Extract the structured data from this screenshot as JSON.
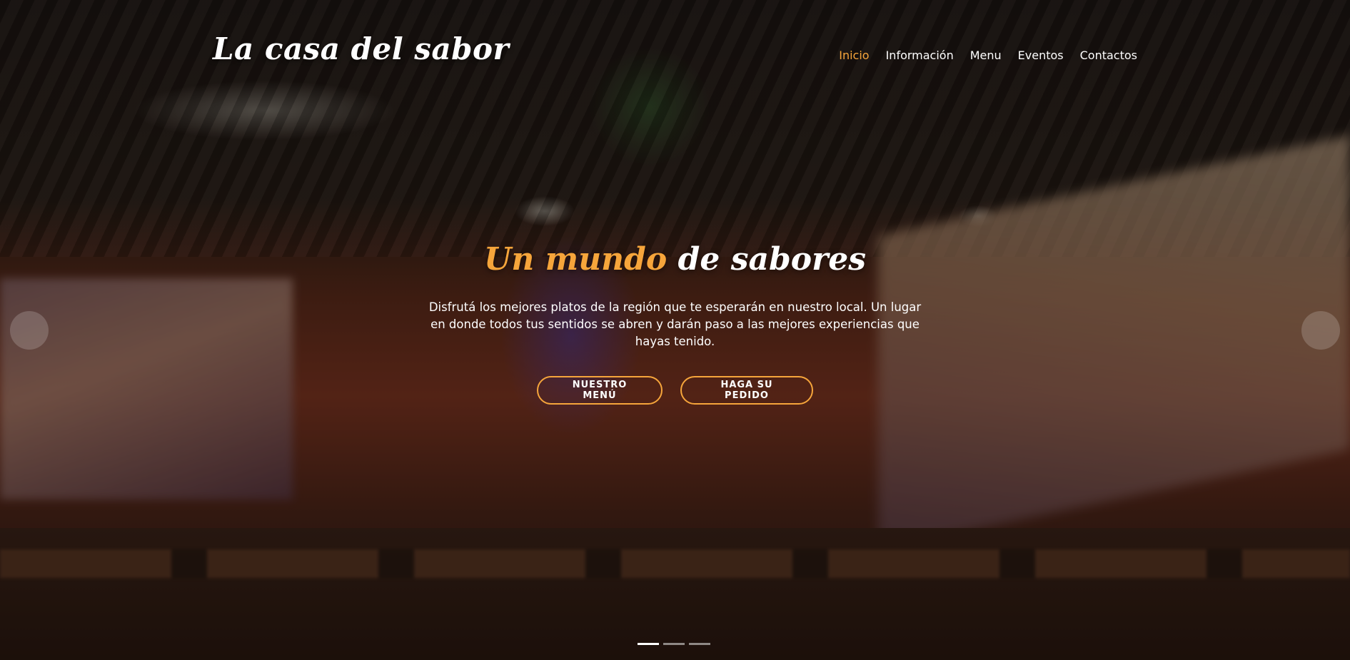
{
  "brand": {
    "logo_text": "La casa del sabor"
  },
  "nav": {
    "items": [
      {
        "label": "Inicio",
        "active": true
      },
      {
        "label": "Información",
        "active": false
      },
      {
        "label": "Menu",
        "active": false
      },
      {
        "label": "Eventos",
        "active": false
      },
      {
        "label": "Contactos",
        "active": false
      }
    ]
  },
  "hero": {
    "headline_accent": "Un mundo",
    "headline_rest": "de sabores",
    "description": "Disfrutá los mejores platos de la región que te esperarán en nuestro local. Un lugar en donde todos tus sentidos se abren y darán paso a las mejores experiencias que hayas tenido.",
    "button_menu": "NUESTRO MENÚ",
    "button_order": "HAGA SU PEDIDO"
  },
  "carousel": {
    "slide_count": 3,
    "active_index": 0,
    "prev_icon": "chevron-left-icon",
    "next_icon": "chevron-right-icon"
  },
  "colors": {
    "accent": "#f6a53b",
    "text": "#ffffff"
  }
}
